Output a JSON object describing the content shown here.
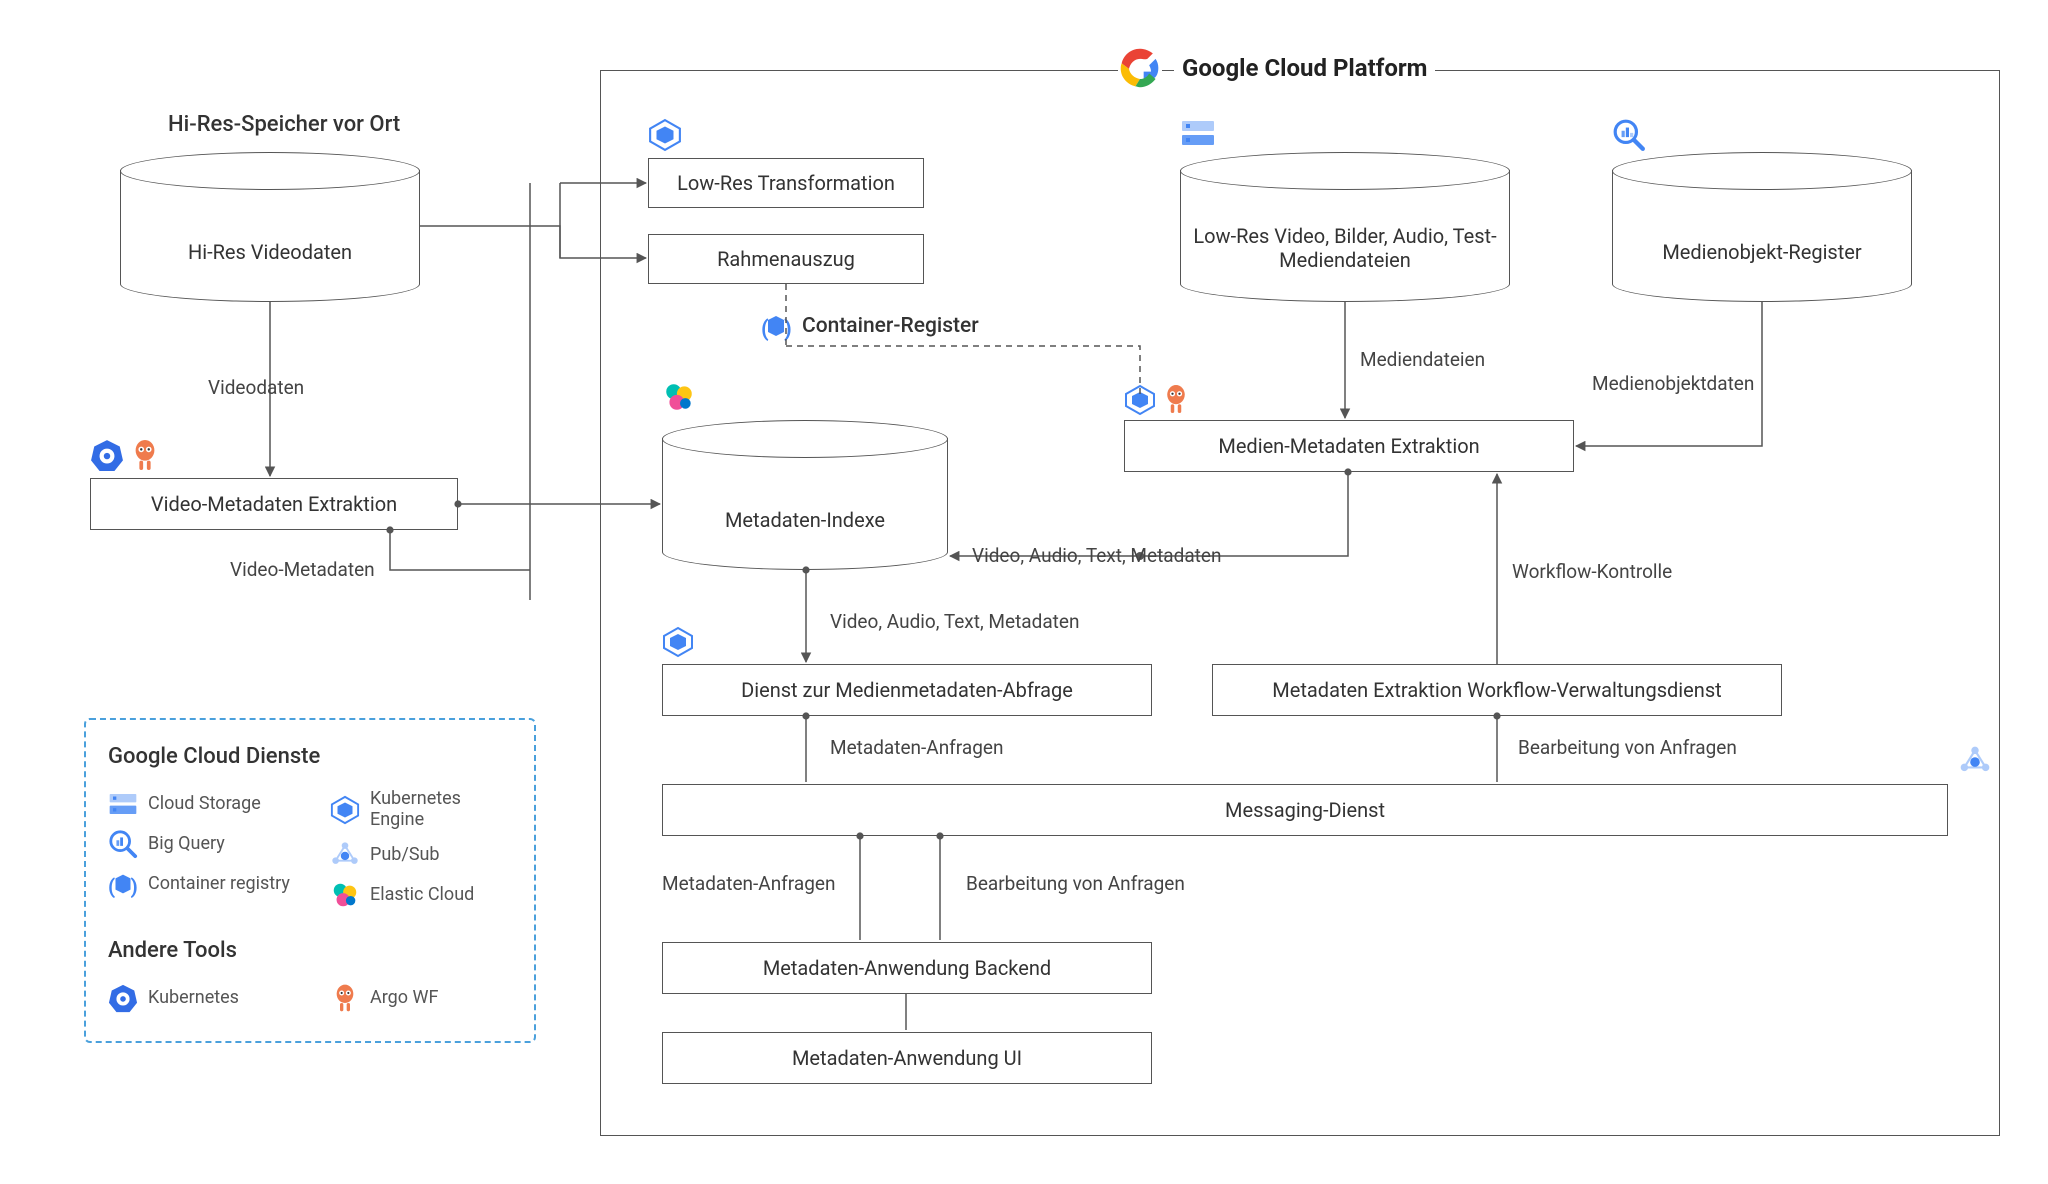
{
  "diagram": {
    "onprem_title": "Hi-Res-Speicher vor Ort",
    "gcp_title": "Google Cloud Platform",
    "nodes": {
      "hires_db": "Hi-Res Videodaten",
      "video_meta_extract": "Video-Metadaten Extraktion",
      "lowres_transform": "Low-Res Transformation",
      "rahmenauszug": "Rahmenauszug",
      "container_register": "Container-Register",
      "metadata_index": "Metadaten-Indexe",
      "lowres_media": "Low-Res Video, Bilder, Audio, Test-Mediendateien",
      "media_obj_register": "Medienobjekt-Register",
      "media_meta_extract": "Medien-Metadaten Extraktion",
      "meta_query_svc": "Dienst zur Medienmetadaten-Abfrage",
      "meta_workflow_svc": "Metadaten Extraktion Workflow-Verwaltungsdienst",
      "messaging_svc": "Messaging-Dienst",
      "meta_app_backend": "Metadaten-Anwendung Backend",
      "meta_app_ui": "Metadaten-Anwendung UI"
    },
    "edges": {
      "videodaten": "Videodaten",
      "video_metadata": "Video-Metadaten",
      "mediendateien": "Mediendateien",
      "medienobjektdaten": "Medienobjektdaten",
      "vatm": "Video, Audio, Text, Metadaten",
      "vatm2": "Video, Audio, Text, Metadaten",
      "workflow_ctrl": "Workflow-Kontrolle",
      "meta_requests": "Metadaten-Anfragen",
      "meta_requests2": "Metadaten-Anfragen",
      "proc_requests": "Bearbeitung von Anfragen",
      "proc_requests2": "Bearbeitung von Anfragen"
    }
  },
  "legend": {
    "gc_title": "Google Cloud Dienste",
    "other_title": "Andere Tools",
    "cloud_storage": "Cloud Storage",
    "big_query": "Big Query",
    "container_registry": "Container registry",
    "kubernetes_engine": "Kubernetes Engine",
    "pubsub": "Pub/Sub",
    "elastic_cloud": "Elastic Cloud",
    "kubernetes": "Kubernetes",
    "argo": "Argo WF"
  },
  "icons": {
    "cloud_storage": "cloud-storage-icon",
    "big_query": "big-query-icon",
    "container_registry": "container-registry-icon",
    "kubernetes_engine": "kubernetes-engine-icon",
    "pubsub": "pubsub-icon",
    "elastic_cloud": "elastic-cloud-icon",
    "kubernetes": "kubernetes-icon",
    "argo": "argo-icon",
    "gcp": "google-cloud-icon"
  }
}
